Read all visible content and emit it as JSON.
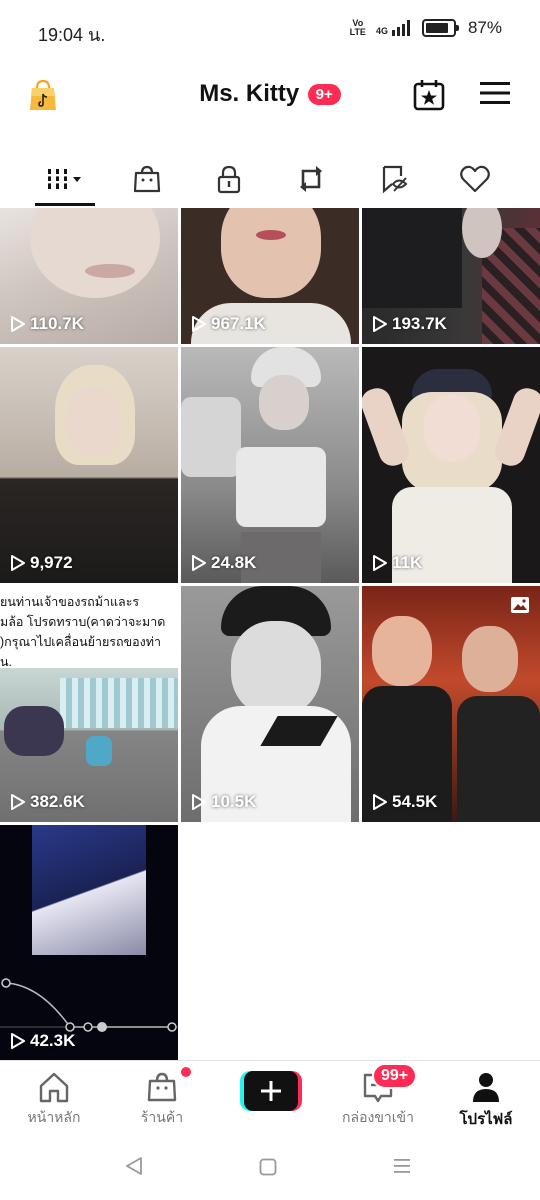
{
  "status": {
    "time": "19:04 น.",
    "volte": "Vo LTE",
    "network": "4G",
    "battery": "87%"
  },
  "header": {
    "title": "Ms. Kitty",
    "badge": "9+"
  },
  "tabs": [
    "videos-grid",
    "shop",
    "private",
    "reposts",
    "favorites-hidden",
    "liked"
  ],
  "videos": [
    {
      "plays": "110.7K"
    },
    {
      "plays": "967.1K"
    },
    {
      "plays": "193.7K"
    },
    {
      "plays": "9,972"
    },
    {
      "plays": "24.8K"
    },
    {
      "plays": "11K"
    },
    {
      "plays": "382.6K",
      "caption": "ยนท่านเจ้าของรถม้าและร\nมล้อ โปรดทราบ(คาดว่าจะมาด\n)กรุณาไปเคลื่อนย้ายรถของท่า\nน."
    },
    {
      "plays": "10.5K"
    },
    {
      "plays": "54.5K"
    },
    {
      "plays": "42.3K"
    }
  ],
  "nav": {
    "home": "หน้าหลัก",
    "shop": "ร้านค้า",
    "inbox": "กล่องขาเข้า",
    "inbox_badge": "99+",
    "profile": "โปรไฟล์"
  }
}
